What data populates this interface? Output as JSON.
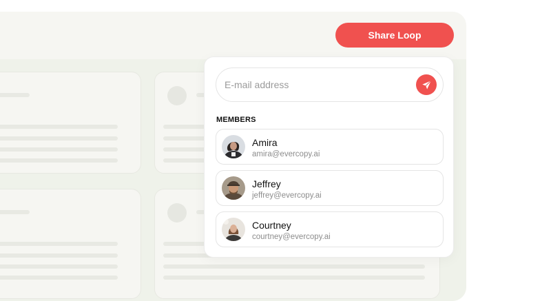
{
  "header": {
    "share_button_label": "Share Loop"
  },
  "invite": {
    "placeholder": "E-mail address",
    "value": "",
    "send_icon": "send-icon"
  },
  "members": {
    "heading": "MEMBERS",
    "list": [
      {
        "name": "Amira",
        "email": "amira@evercopy.ai"
      },
      {
        "name": "Jeffrey",
        "email": "jeffrey@evercopy.ai"
      },
      {
        "name": "Courtney",
        "email": "courtney@evercopy.ai"
      }
    ]
  },
  "colors": {
    "accent": "#f0514f",
    "panel_background": "#f6f6f2",
    "content_background": "#eff2ea"
  }
}
